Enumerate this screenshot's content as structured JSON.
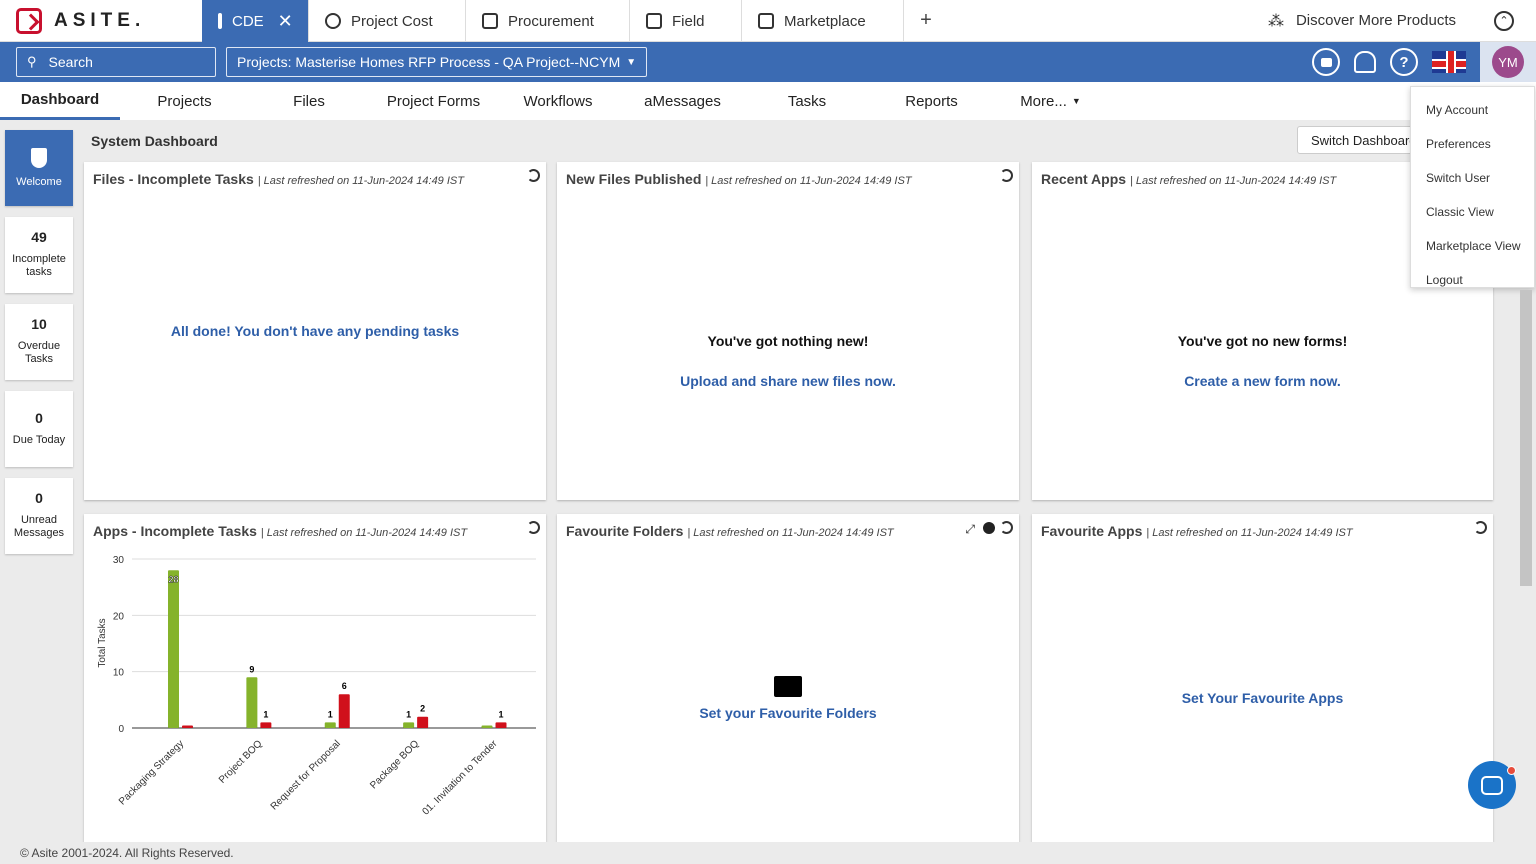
{
  "brand": {
    "name": "ASITE."
  },
  "app_tabs": [
    {
      "label": "CDE",
      "icon": "database-icon",
      "active": true
    },
    {
      "label": "Project Cost",
      "icon": "gauge-icon"
    },
    {
      "label": "Procurement",
      "icon": "procurement-icon"
    },
    {
      "label": "Field",
      "icon": "field-icon"
    },
    {
      "label": "Marketplace",
      "icon": "store-icon"
    }
  ],
  "add_tab": "+",
  "discover": "Discover More Products",
  "search": {
    "label": "Search"
  },
  "project_selector": "Projects: Masterise Homes RFP Process - QA Project--NCYM",
  "user": {
    "initials": "YM"
  },
  "help_icon_text": "?",
  "nav": [
    "Dashboard",
    "Projects",
    "Files",
    "Project Forms",
    "Workflows",
    "aMessages",
    "Tasks",
    "Reports",
    "More..."
  ],
  "rail": [
    {
      "label": "Welcome"
    },
    {
      "num": "49",
      "label": "Incomplete tasks"
    },
    {
      "num": "10",
      "label": "Overdue Tasks"
    },
    {
      "num": "0",
      "label": "Due Today"
    },
    {
      "num": "0",
      "label": "Unread Messages"
    }
  ],
  "dashboard": {
    "title": "System Dashboard",
    "switch_label": "Switch Dashboard"
  },
  "refreshed": "| Last refreshed on 11-Jun-2024 14:49 IST",
  "widgets": {
    "files_tasks": {
      "title": "Files - Incomplete Tasks",
      "message": "All done! You don't have any pending tasks"
    },
    "new_files": {
      "title": "New Files Published",
      "message": "You've got nothing new!",
      "link": "Upload and share new files now."
    },
    "recent_apps": {
      "title": "Recent Apps",
      "message": "You've got no new forms!",
      "link": "Create a new form now."
    },
    "apps_tasks": {
      "title": "Apps - Incomplete Tasks"
    },
    "fav_folders": {
      "title": "Favourite Folders",
      "link": "Set your Favourite Folders"
    },
    "fav_apps": {
      "title": "Favourite Apps",
      "link": "Set Your Favourite Apps"
    }
  },
  "chart_data": {
    "type": "bar",
    "categories": [
      "Packaging Strategy",
      "Project BOQ",
      "Request for Proposal",
      "Package BOQ",
      "01. Invitation to Tender"
    ],
    "series": [
      {
        "values": [
          28,
          9,
          1,
          1,
          0
        ],
        "color": "#85b32b"
      },
      {
        "values": [
          0,
          1,
          6,
          2,
          1
        ],
        "color": "#d0101b"
      }
    ],
    "data_labels": [
      [
        "28",
        "9",
        "1",
        "1",
        ""
      ],
      [
        "",
        "1",
        "6",
        "2",
        "1"
      ]
    ],
    "ylabel": "Total Tasks",
    "yticks": [
      0,
      10,
      20,
      30
    ],
    "ylim": [
      0,
      30
    ],
    "grid": true
  },
  "user_menu": [
    "My Account",
    "Preferences",
    "Switch User",
    "Classic View",
    "Marketplace View",
    "Logout"
  ],
  "footer": "© Asite 2001-2024. All Rights Reserved."
}
